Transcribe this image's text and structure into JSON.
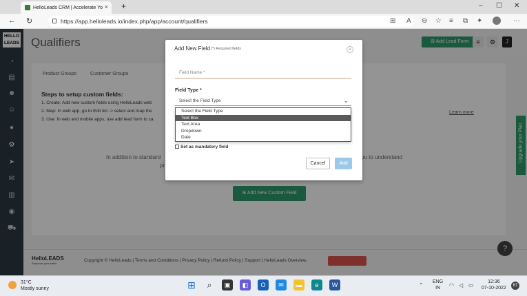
{
  "browser": {
    "tab_title": "HelloLeads CRM | Accelerate Yo",
    "url": "https://app.helloleads.io/index.php/app/account/qualifiers"
  },
  "app": {
    "logo_text": "HELLO LEADS",
    "page_title": "Qualifiers",
    "add_lead_form": "Add Lead Form",
    "user_initial": "J",
    "tabs": [
      "Product Groups",
      "Customer Groups"
    ],
    "steps_title": "Steps to setup custom fields:",
    "steps": [
      "1. Create: Add new custom fields using HelloLeads web",
      "2. Map: In web app, go to Edit list -> select and map the",
      "3. Use: In web and mobile apps, use add lead form to ca"
    ],
    "learn_more": "Learn more",
    "bg_text_left": "In addition to standard",
    "bg_text_left2": "pr",
    "bg_text_right": "you to understand",
    "add_custom_field": "Add New Custom Field",
    "upgrade_label": "Upgrade your Plan",
    "footer": {
      "logo": "HelloLEADS",
      "tagline": "Empower your sales",
      "links": "Copyright © HelloLeads  |  Terms and Conditions  |  Privacy Policy  |  Refund Policy  |  Support  |  HelloLeads Overview"
    },
    "help_icon": "?"
  },
  "modal": {
    "title": "Add New Field",
    "required_note": "(*) Required fields",
    "field_name_placeholder": "Field Name *",
    "field_type_label": "Field Type *",
    "field_type_selected": "Select the Field Type",
    "options": [
      "Select the Field Type",
      "Text Box",
      "Text Area",
      "Dropdown",
      "Date"
    ],
    "selected_option_index": 1,
    "mandatory_label": "Set as mandatory field",
    "cancel": "Cancel",
    "add": "Add"
  },
  "taskbar": {
    "weather_temp": "31°C",
    "weather_desc": "Mostly sunny",
    "lang1": "ENG",
    "lang2": "IN",
    "time": "12:36",
    "date": "07-10-2022",
    "notif_count": "67"
  },
  "colors": {
    "brand_green": "#2e9a6b",
    "sidebar": "#2b3a42",
    "add_disabled": "#9cc9e8"
  }
}
